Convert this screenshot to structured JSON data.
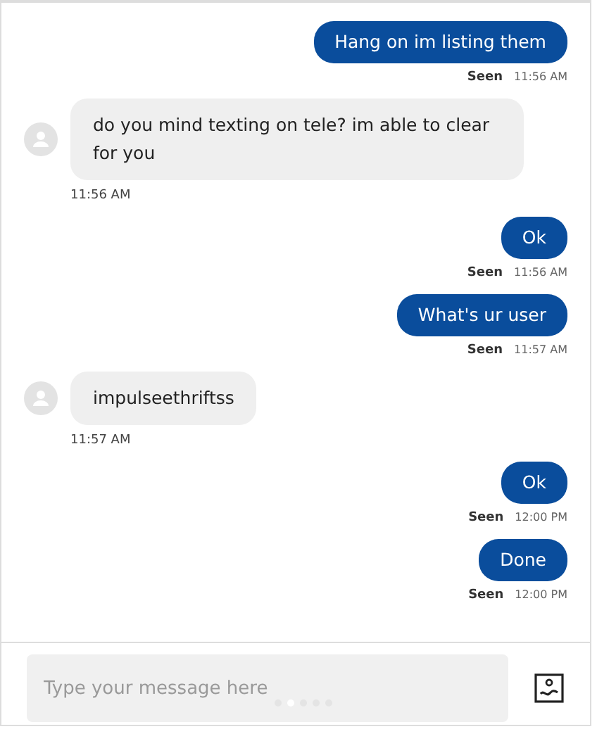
{
  "messages": [
    {
      "kind": "sent",
      "text": "Hang on im listing them",
      "status": "Seen",
      "time": "11:56 AM"
    },
    {
      "kind": "received",
      "text": "do you mind texting on tele? im able to clear for you",
      "time": "11:56 AM"
    },
    {
      "kind": "sent",
      "text": "Ok",
      "status": "Seen",
      "time": "11:56 AM"
    },
    {
      "kind": "sent",
      "text": "What's ur user",
      "status": "Seen",
      "time": "11:57 AM"
    },
    {
      "kind": "received",
      "text": "impulseethriftss",
      "time": "11:57 AM"
    },
    {
      "kind": "sent",
      "text": "Ok",
      "status": "Seen",
      "time": "12:00 PM"
    },
    {
      "kind": "sent",
      "text": "Done",
      "status": "Seen",
      "time": "12:00 PM"
    }
  ],
  "composer": {
    "placeholder": "Type your message here"
  },
  "pager": [
    {
      "selected": false
    },
    {
      "selected": true
    },
    {
      "selected": false
    },
    {
      "selected": false
    },
    {
      "selected": false
    }
  ]
}
